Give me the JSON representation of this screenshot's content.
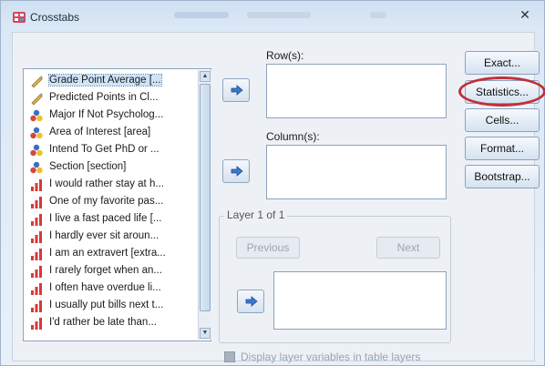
{
  "window": {
    "title": "Crosstabs",
    "close_label": "✕"
  },
  "variables": [
    {
      "label": "Grade Point Average [...",
      "icon": "scale-icon",
      "selected": true
    },
    {
      "label": "Predicted Points in Cl...",
      "icon": "scale-icon"
    },
    {
      "label": "Major If Not Psycholog...",
      "icon": "nominal-icon"
    },
    {
      "label": "Area of Interest [area]",
      "icon": "nominal-icon"
    },
    {
      "label": "Intend To Get PhD or ...",
      "icon": "nominal-icon"
    },
    {
      "label": "Section [section]",
      "icon": "nominal-icon"
    },
    {
      "label": "I would rather stay at h...",
      "icon": "ordinal-icon"
    },
    {
      "label": "One of my favorite pas...",
      "icon": "ordinal-icon"
    },
    {
      "label": "I live a fast paced life [...",
      "icon": "ordinal-icon"
    },
    {
      "label": "I hardly ever sit aroun...",
      "icon": "ordinal-icon"
    },
    {
      "label": "I am an extravert [extra...",
      "icon": "ordinal-icon"
    },
    {
      "label": "I rarely forget when an...",
      "icon": "ordinal-icon"
    },
    {
      "label": "I often have overdue li...",
      "icon": "ordinal-icon"
    },
    {
      "label": "I usually put bills next t...",
      "icon": "ordinal-icon"
    },
    {
      "label": "I'd rather be late than...",
      "icon": "ordinal-icon"
    }
  ],
  "rows_label": "Row(s):",
  "columns_label": "Column(s):",
  "layer": {
    "title": "Layer 1 of 1",
    "previous_label": "Previous",
    "next_label": "Next"
  },
  "display_layer_label": "Display layer variables in table layers",
  "buttons": {
    "exact": "Exact...",
    "statistics": "Statistics...",
    "cells": "Cells...",
    "format": "Format...",
    "bootstrap": "Bootstrap..."
  },
  "colors": {
    "highlight": "#c0303a",
    "accent": "#3a78c8"
  }
}
